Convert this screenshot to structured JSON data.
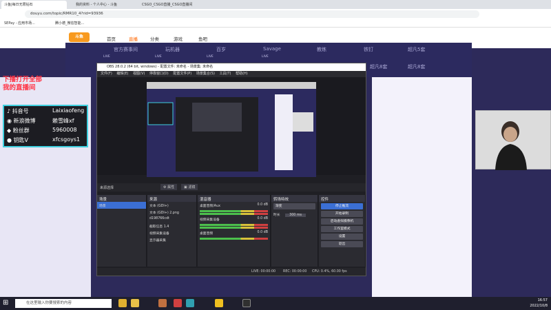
{
  "browser": {
    "tabs": [
      "斗鱼|每日无限钻石",
      "我的资料 - 个人中心 - 斗鱼",
      "CSGO_CSGO直播_CSGO直播间"
    ],
    "url": "douyu.com/topic/RMR10_4?rid=93936",
    "bookmarks": [
      "SEPay - 应用市场...",
      "腾小德_微信智能...",
      "其他书签"
    ]
  },
  "site": {
    "logo": "斗鱼",
    "nav": [
      "首页",
      "直播",
      "分类",
      "游戏",
      "鱼吧"
    ],
    "room_tabs": [
      "官方赛事间",
      "玩机器",
      "百岁",
      "Savage",
      "教练",
      "铁钉",
      "超凡5套",
      "超凡8套",
      "超凡8套"
    ],
    "live_label": "LIVE"
  },
  "overlay": {
    "title_line1": "下播打开全部",
    "title_line2": "我的直播间",
    "rows": [
      {
        "label": "抖音号",
        "value": "Laixiaofeng"
      },
      {
        "label": "新浪微博",
        "value": "赖雪峰xf"
      },
      {
        "label": "粉丝群",
        "value": "5960008"
      },
      {
        "label": "钥匙V",
        "value": "xfcsgoys1"
      }
    ]
  },
  "obs": {
    "title": "OBS 28.0.2 (64 bit, windows) - 配置文件: 未命名 - 场景集: 未命名",
    "menu": [
      "文件(F)",
      "编辑(E)",
      "视图(V)",
      "停靠窗口(D)",
      "配置文件(P)",
      "场景集合(S)",
      "工具(T)",
      "帮助(H)"
    ],
    "no_source": "来源选择",
    "props_btn": "属性",
    "filter_btn": "滤镜",
    "docks": {
      "scenes": {
        "title": "场景",
        "items": [
          "场景"
        ]
      },
      "sources": {
        "title": "来源",
        "items": [
          "文本 (GDI+)",
          "文本 (GDI+) 2.png",
          "d198766cdt",
          "截取信息 1.4",
          "视频采集设备",
          "显示器采集"
        ]
      },
      "mixer": {
        "title": "混音器",
        "items": [
          {
            "name": "桌面音频/Aux",
            "db": "0.0 dB"
          },
          {
            "name": "视频采集设备",
            "db": "0.0 dB"
          },
          {
            "name": "桌面音频",
            "db": "0.0 dB"
          }
        ]
      },
      "transitions": {
        "title": "转场特效",
        "type": "渐变",
        "duration_label": "时长",
        "duration": "300 ms"
      },
      "controls": {
        "title": "控件",
        "buttons": [
          "停止推流",
          "开始录制",
          "启动虚拟摄像机",
          "工作室模式",
          "设置",
          "退出"
        ]
      }
    },
    "status": {
      "live": "LIVE: 00:00:00",
      "rec": "REC: 00:00:00",
      "cpu": "CPU: 0.4%, 60.00 fps"
    }
  },
  "taskbar": {
    "search_placeholder": "在这里输入你要搜索的内容",
    "time": "16:57",
    "date": "2022/10/8"
  }
}
